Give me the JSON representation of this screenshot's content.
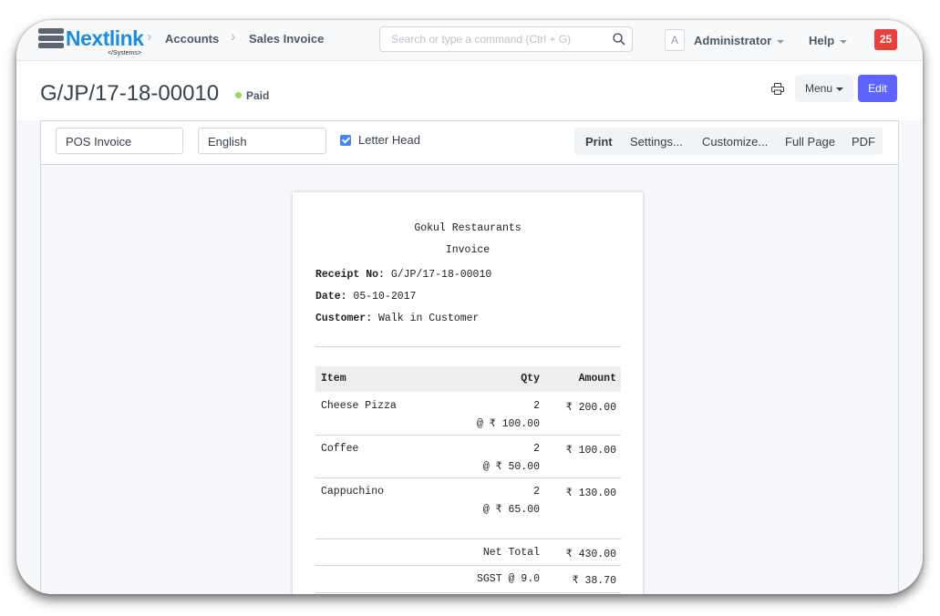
{
  "navbar": {
    "brand": "Nextlink",
    "brand_sub": "</Systems>",
    "breadcrumbs": [
      "Accounts",
      "Sales Invoice"
    ],
    "search_placeholder": "Search or type a command (Ctrl + G)",
    "avatar_letter": "A",
    "user_label": "Administrator",
    "help_label": "Help",
    "notification_count": "25"
  },
  "page": {
    "title": "G/JP/17-18-00010",
    "status": "Paid",
    "menu_label": "Menu",
    "edit_label": "Edit"
  },
  "print_toolbar": {
    "print_format": "POS Invoice",
    "language": "English",
    "letter_head_label": "Letter Head",
    "letter_head_checked": true,
    "actions": [
      "Print",
      "Settings...",
      "Customize...",
      "Full Page",
      "PDF"
    ]
  },
  "receipt": {
    "company": "Gokul Restaurants",
    "doc_type": "Invoice",
    "receipt_no_label": "Receipt No:",
    "receipt_no": "G/JP/17-18-00010",
    "date_label": "Date:",
    "date": "05-10-2017",
    "customer_label": "Customer:",
    "customer": "Walk in Customer",
    "columns": [
      "Item",
      "Qty",
      "Amount"
    ],
    "items": [
      {
        "name": "Cheese Pizza",
        "qty": "2",
        "rate": "@ ₹ 100.00",
        "amount": "₹ 200.00"
      },
      {
        "name": "Coffee",
        "qty": "2",
        "rate": "@ ₹ 50.00",
        "amount": "₹ 100.00"
      },
      {
        "name": "Cappuchino",
        "qty": "2",
        "rate": "@ ₹ 65.00",
        "amount": "₹ 130.00"
      }
    ],
    "net_total_label": "Net Total",
    "net_total": "₹ 430.00",
    "tax_label": "SGST @ 9.0",
    "tax_amount": "₹ 38.70"
  },
  "colors": {
    "brand": "#1d8ce0",
    "primary": "#5e64ff",
    "paid_dot": "#98d85b",
    "notification": "#e8403a"
  }
}
